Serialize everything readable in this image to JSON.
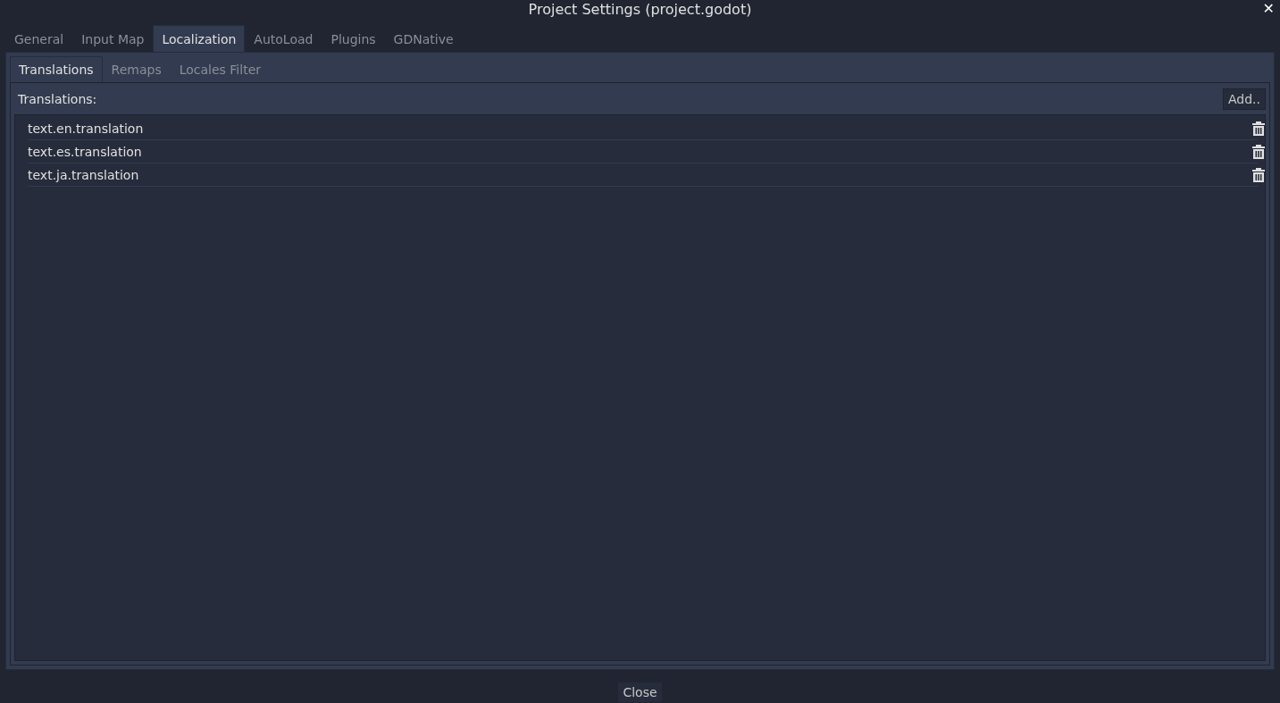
{
  "window": {
    "title": "Project Settings (project.godot)",
    "close": "✕"
  },
  "tabs": [
    {
      "label": "General",
      "selected": false
    },
    {
      "label": "Input Map",
      "selected": false
    },
    {
      "label": "Localization",
      "selected": true
    },
    {
      "label": "AutoLoad",
      "selected": false
    },
    {
      "label": "Plugins",
      "selected": false
    },
    {
      "label": "GDNative",
      "selected": false
    }
  ],
  "subtabs": [
    {
      "label": "Translations",
      "selected": true
    },
    {
      "label": "Remaps",
      "selected": false
    },
    {
      "label": "Locales Filter",
      "selected": false
    }
  ],
  "translations": {
    "label": "Translations:",
    "add_button": "Add..",
    "items": [
      "text.en.translation",
      "text.es.translation",
      "text.ja.translation"
    ]
  },
  "footer": {
    "close_button": "Close"
  }
}
